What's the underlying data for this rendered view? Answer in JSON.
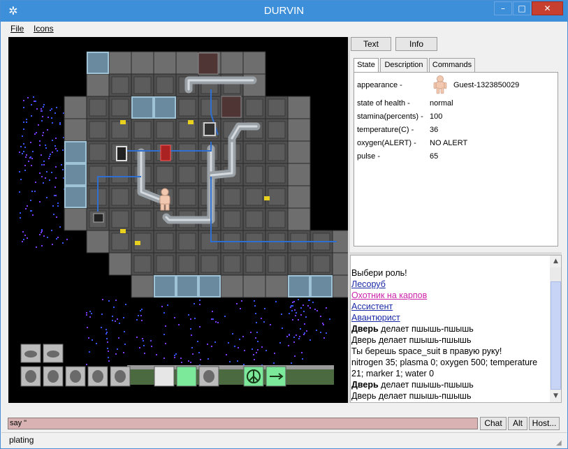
{
  "window": {
    "title": "DURVIN",
    "app_icon": "gear-star-icon",
    "min_glyph": "–",
    "max_glyph": "□",
    "close_glyph": "✕"
  },
  "menu": {
    "file": "File",
    "icons": "Icons"
  },
  "buttons": {
    "text": "Text",
    "info": "Info"
  },
  "tabs": {
    "state": "State",
    "description": "Description",
    "commands": "Commands",
    "active": "state"
  },
  "stats": [
    {
      "label": "appearance -",
      "value": "Guest-1323850029",
      "has_avatar": true
    },
    {
      "label": "state of health -",
      "value": "normal"
    },
    {
      "label": "stamina(percents) -",
      "value": "100"
    },
    {
      "label": "temperature(C) -",
      "value": "36"
    },
    {
      "label": "oxygen(ALERT) -",
      "value": "NO ALERT"
    },
    {
      "label": "pulse -",
      "value": "65"
    }
  ],
  "chat": {
    "prompt": "Выбери роль!",
    "roles": [
      "Лесоруб",
      "Охотник на карпов",
      "Ассистент",
      "Авантюрист"
    ],
    "door1_bold": "Дверь",
    "door1_rest": " делает пшышь-пшышь",
    "door2": "Дверь делает пшышь-пшышь",
    "take_suit": "Ты берешь space_suit в правую руку!",
    "gases": "nitrogen 35; plasma 0; oxygen 500; temperature 21; marker 1; water 0",
    "door3_bold": "Дверь",
    "door3_rest": " делает пшышь-пшышь",
    "door4": "Дверь делает пшышь-пшышь"
  },
  "colors": {
    "link": "#1a2aa6",
    "link_alt": "#cc22aa",
    "input_bg": "#d9b3b3",
    "title_bar": "#3d8fd9",
    "close": "#c7402f",
    "space_star": "#7a3cff",
    "pipe_blue": "#2f6fd0"
  },
  "input": {
    "value": "say \""
  },
  "bottom_buttons": {
    "chat": "Chat",
    "alt": "Alt",
    "host": "Host..."
  },
  "status": "plating",
  "hud": {
    "top_row_icons": [
      "floor-icon",
      "mouse-icon"
    ],
    "action_icons": [
      "body-icon",
      "hand-icon",
      "helmet-icon",
      "suit-icon",
      "armor-icon",
      "empty-slot",
      "green-slot",
      "person-icon",
      "peace-icon",
      "arrow-icon"
    ]
  }
}
